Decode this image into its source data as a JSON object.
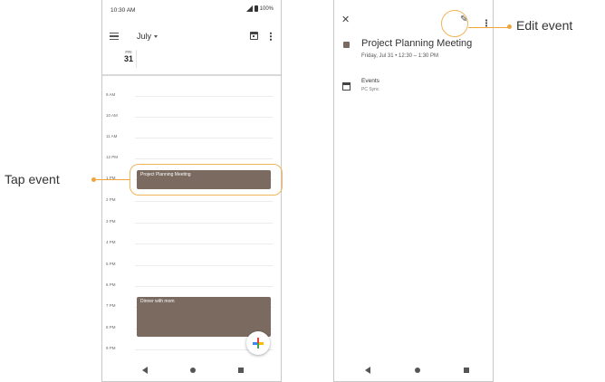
{
  "colors": {
    "accent": "#f0a53c",
    "event": "#7a6a60"
  },
  "left_phone": {
    "status": {
      "time": "10:30 AM",
      "battery": "100%"
    },
    "appbar": {
      "month": "July"
    },
    "date": {
      "dow": "FRI",
      "day": "31"
    },
    "time_labels": [
      "9 AM",
      "10 AM",
      "11 AM",
      "12 PM",
      "1 PM",
      "2 PM",
      "3 PM",
      "4 PM",
      "5 PM",
      "6 PM",
      "7 PM",
      "8 PM",
      "9 PM"
    ],
    "events": [
      {
        "title": "Project Planning Meeting"
      },
      {
        "title": "Dinner with mom"
      }
    ]
  },
  "right_phone": {
    "event_title": "Project Planning Meeting",
    "event_time": "Friday, Jul 31  •  12:30 – 1:30 PM",
    "calendar_name": "Events",
    "calendar_sub": "PC Sync"
  },
  "annotations": {
    "tap_event": "Tap event",
    "edit_event": "Edit event"
  }
}
